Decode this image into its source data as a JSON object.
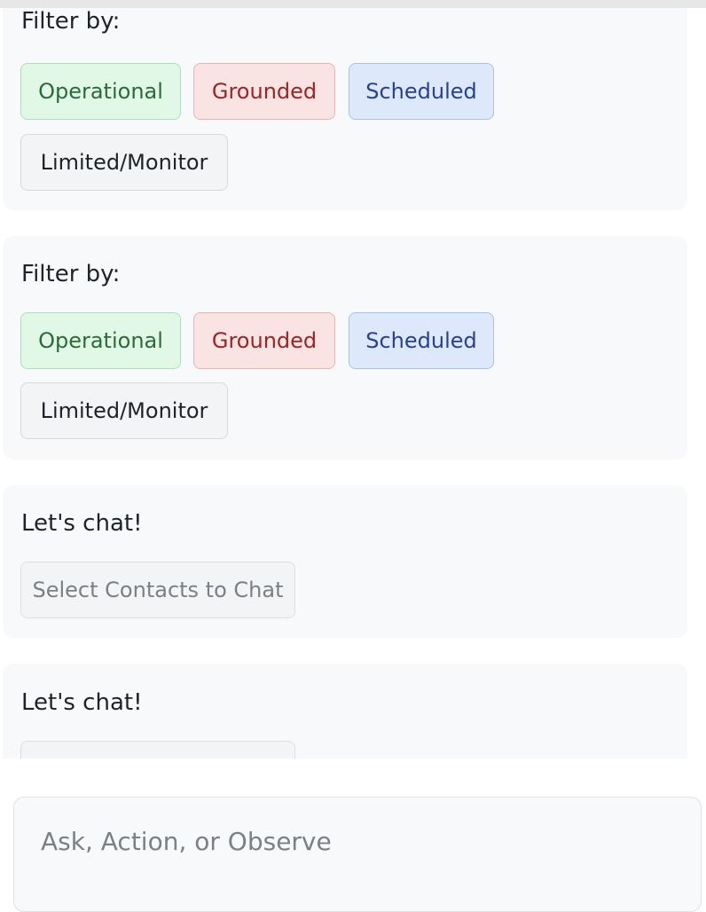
{
  "filter_cards": [
    {
      "title": "Filter by:",
      "filters": [
        "Operational",
        "Grounded",
        "Scheduled",
        "Limited/Monitor"
      ]
    },
    {
      "title": "Filter by:",
      "filters": [
        "Operational",
        "Grounded",
        "Scheduled",
        "Limited/Monitor"
      ]
    }
  ],
  "chat_cards": [
    {
      "title": "Let's chat!",
      "button_label": "Select Contacts to Chat"
    },
    {
      "title": "Let's chat!",
      "button_label": ""
    }
  ],
  "composer": {
    "placeholder": "Ask, Action, or Observe",
    "value": ""
  },
  "colors": {
    "operational": "#2b6b3a",
    "grounded": "#9c2424",
    "scheduled": "#283f9a",
    "card_background": "#f8f9fb"
  }
}
